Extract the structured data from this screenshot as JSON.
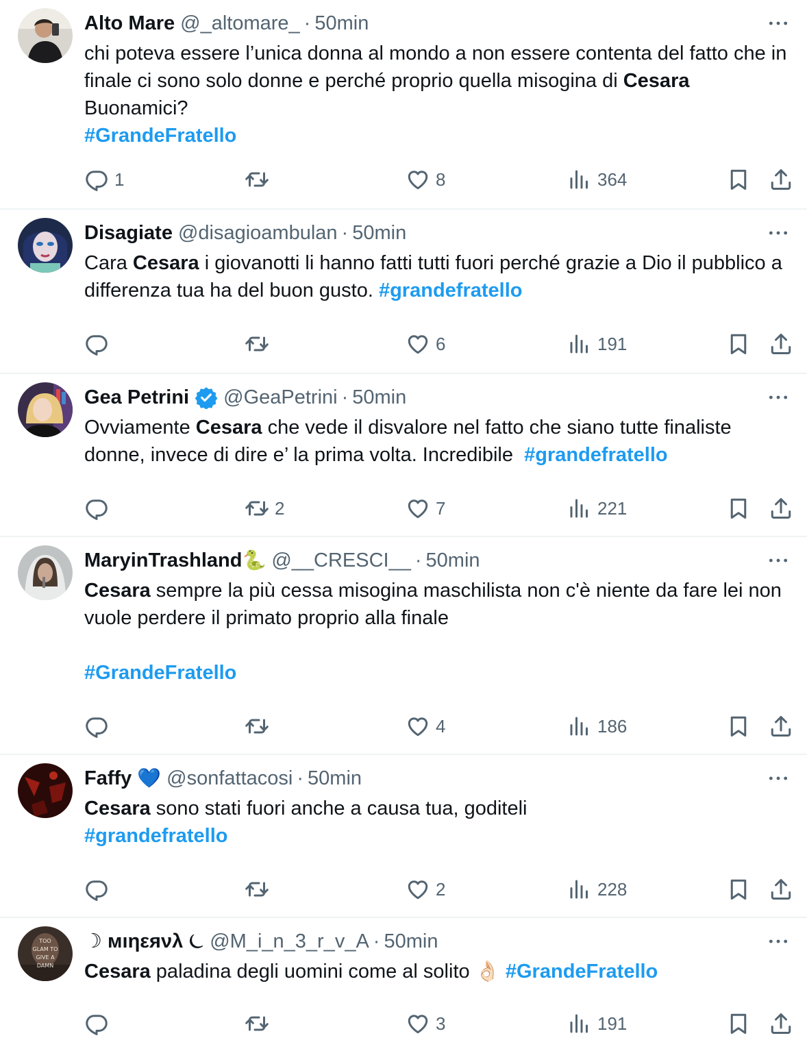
{
  "tweets": [
    {
      "name": "Alto Mare",
      "handle": "@_altomare_",
      "dot": "·",
      "time": "50min",
      "text": {
        "p1": "chi poteva essere l’unica donna al mondo a non essere contenta del fatto che in finale ci sono solo donne e perché proprio quella misogina di ",
        "bold": "Cesara",
        "p2": " Buonamici?",
        "tag": "#GrandeFratello"
      },
      "replies": "1",
      "retweets": "",
      "likes": "8",
      "views": "364"
    },
    {
      "name": "Disagiate",
      "handle": "@disagioambulan",
      "dot": "·",
      "time": "50min",
      "text": {
        "p1": "Cara ",
        "bold": "Cesara",
        "p2": " i giovanotti li hanno fatti tutti fuori perché grazie a Dio il pubblico a differenza tua ha del buon gusto. ",
        "tag": "#grandefratello"
      },
      "replies": "",
      "retweets": "",
      "likes": "6",
      "views": "191"
    },
    {
      "name": "Gea Petrini",
      "handle": "@GeaPetrini",
      "dot": "·",
      "time": "50min",
      "verified": "verified-badge-icon",
      "text": {
        "p1": "Ovviamente ",
        "bold": "Cesara",
        "p2": " che vede il disvalore nel fatto che siano tutte finaliste donne, invece di dire e’ la prima volta. Incredibile  ",
        "tag": "#grandefratello"
      },
      "replies": "",
      "retweets": "2",
      "likes": "7",
      "views": "221"
    },
    {
      "name": "MaryinTrashland",
      "name_emoji": "🐍",
      "handle": "@__CRESCI__",
      "dot": "·",
      "time": "50min",
      "text": {
        "bold": "Cesara",
        "p2": " sempre la più cessa misogina maschilista non c'è niente da fare lei non vuole perdere il primato proprio alla finale",
        "tag": "#GrandeFratello"
      },
      "replies": "",
      "retweets": "",
      "likes": "4",
      "views": "186"
    },
    {
      "name": "Faffy",
      "name_emoji": "💙",
      "handle": "@sonfattacosi",
      "dot": "·",
      "time": "50min",
      "text": {
        "bold": "Cesara",
        "p2": " sono stati fuori anche a causa tua, goditeli",
        "tag": "#grandefratello"
      },
      "replies": "",
      "retweets": "",
      "likes": "2",
      "views": "228"
    },
    {
      "name": "☽ мıηεяνλ ⏾",
      "handle": "@M_i_n_3_r_v_A",
      "dot": "·",
      "time": "50min",
      "text": {
        "bold": "Cesara",
        "p2": " paladina degli uomini come al solito ",
        "emoji": "👌🏻",
        "tag": "#GrandeFratello"
      },
      "avatar_text": [
        "TOO",
        "GLAM TO",
        "GIVE A",
        "DAMN"
      ],
      "replies": "",
      "retweets": "",
      "likes": "3",
      "views": "191"
    }
  ],
  "colors": {
    "link": "#1d9bf0",
    "secondary": "#536471",
    "text": "#0f1419",
    "divider": "#eff3f4"
  },
  "icons": [
    "reply-icon",
    "retweet-icon",
    "like-icon",
    "views-icon",
    "bookmark-icon",
    "share-icon",
    "more-icon"
  ]
}
